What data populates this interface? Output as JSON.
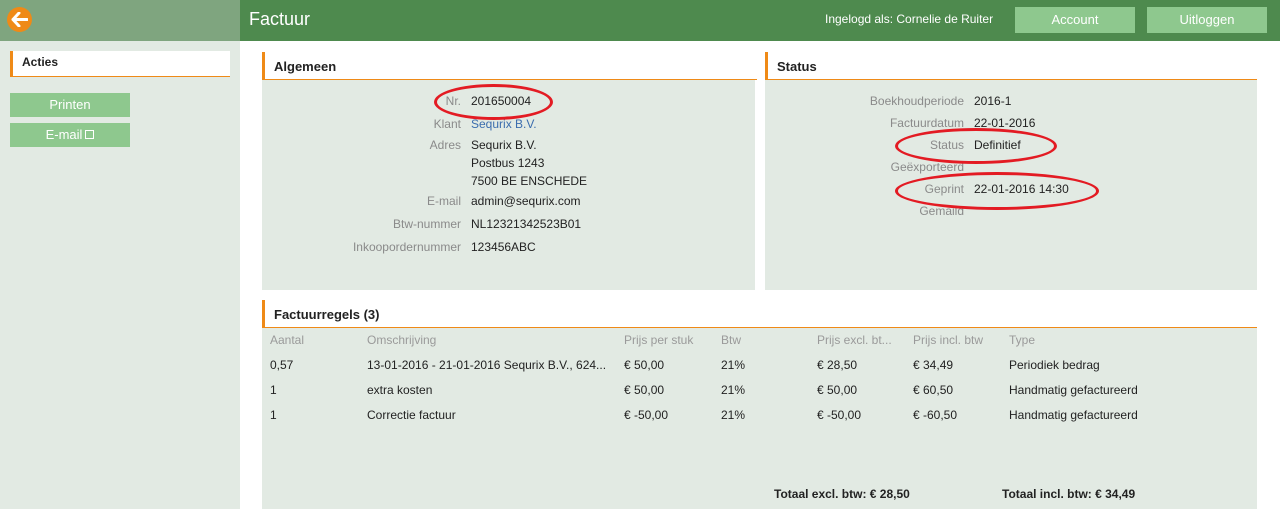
{
  "header": {
    "title": "Factuur",
    "logged_in": "Ingelogd als: Cornelie de Ruiter",
    "account_label": "Account",
    "logout_label": "Uitloggen"
  },
  "sidebar": {
    "title": "Acties",
    "print_label": "Printen",
    "email_label": "E-mail"
  },
  "general": {
    "title": "Algemeen",
    "fields": [
      {
        "label": "Nr.",
        "value": "201650004"
      },
      {
        "label": "Klant",
        "value": "Sequrix B.V."
      },
      {
        "label": "Adres",
        "lines": [
          "Sequrix B.V.",
          "Postbus 1243",
          "7500 BE ENSCHEDE"
        ]
      },
      {
        "label": "E-mail",
        "value": "admin@sequrix.com"
      },
      {
        "label": "Btw-nummer",
        "value": "NL12321342523B01"
      },
      {
        "label": "Inkoopordernummer",
        "value": "123456ABC"
      }
    ]
  },
  "status": {
    "title": "Status",
    "fields": [
      {
        "label": "Boekhoudperiode",
        "value": "2016-1"
      },
      {
        "label": "Factuurdatum",
        "value": "22-01-2016"
      },
      {
        "label": "Status",
        "value": "Definitief"
      },
      {
        "label": "Geëxporteerd",
        "value": ""
      },
      {
        "label": "Geprint",
        "value": "22-01-2016 14:30"
      },
      {
        "label": "Gemaild",
        "value": ""
      }
    ]
  },
  "lines": {
    "title": "Factuurregels (3)",
    "columns": [
      "Aantal",
      "Omschrijving",
      "Prijs per stuk",
      "Btw",
      "Prijs excl. bt...",
      "Prijs incl. btw",
      "Type"
    ],
    "rows": [
      [
        "0,57",
        "13-01-2016 - 21-01-2016 Sequrix B.V., 624...",
        "€ 50,00",
        "21%",
        "€ 28,50",
        "€ 34,49",
        "Periodiek bedrag"
      ],
      [
        "1",
        "extra kosten",
        "€ 50,00",
        "21%",
        "€ 50,00",
        "€ 60,50",
        "Handmatig gefactureerd"
      ],
      [
        "1",
        "Correctie factuur",
        "€ -50,00",
        "21%",
        "€ -50,00",
        "€ -60,50",
        "Handmatig gefactureerd"
      ]
    ],
    "total_excl": "Totaal excl. btw: € 28,50",
    "total_incl": "Totaal incl. btw: € 34,49"
  },
  "colors": {
    "header_green": "#4e8a4e",
    "button_green": "#8ec88e",
    "accent_orange": "#ef8a17",
    "panel_bg": "#e2eae3",
    "annotation_red": "#e31b23"
  }
}
